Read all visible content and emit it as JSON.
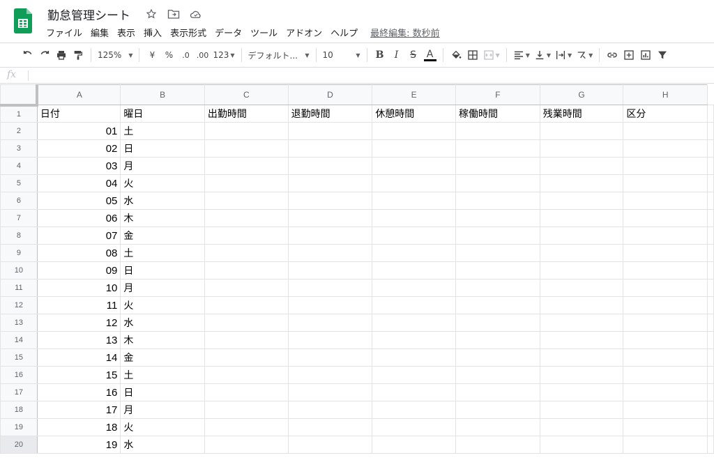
{
  "app": {
    "doc_title": "勤怠管理シート",
    "last_edit": "最終編集: 数秒前"
  },
  "menu": [
    "ファイル",
    "編集",
    "表示",
    "挿入",
    "表示形式",
    "データ",
    "ツール",
    "アドオン",
    "ヘルプ"
  ],
  "toolbar": {
    "zoom": "125%",
    "currency": "¥",
    "percent": "%",
    "decimal_decrease": ".0",
    "decimal_increase": ".00",
    "number_format": "123",
    "font": "デフォルト...",
    "font_size": "10",
    "bold": "B",
    "italic": "I",
    "strike": "S",
    "text_color": "A"
  },
  "formula_bar": {
    "fx_label": "fx"
  },
  "grid": {
    "columns": [
      "A",
      "B",
      "C",
      "D",
      "E",
      "F",
      "G",
      "H"
    ],
    "header_row": [
      "日付",
      "曜日",
      "出勤時間",
      "退勤時間",
      "休憩時間",
      "稼働時間",
      "残業時間",
      "区分"
    ],
    "rows": [
      {
        "n": "1"
      },
      {
        "n": "2",
        "a": "01",
        "b": "土"
      },
      {
        "n": "3",
        "a": "02",
        "b": "日"
      },
      {
        "n": "4",
        "a": "03",
        "b": "月"
      },
      {
        "n": "5",
        "a": "04",
        "b": "火"
      },
      {
        "n": "6",
        "a": "05",
        "b": "水"
      },
      {
        "n": "7",
        "a": "06",
        "b": "木"
      },
      {
        "n": "8",
        "a": "07",
        "b": "金"
      },
      {
        "n": "9",
        "a": "08",
        "b": "土"
      },
      {
        "n": "10",
        "a": "09",
        "b": "日"
      },
      {
        "n": "11",
        "a": "10",
        "b": "月"
      },
      {
        "n": "12",
        "a": "11",
        "b": "火"
      },
      {
        "n": "13",
        "a": "12",
        "b": "水"
      },
      {
        "n": "14",
        "a": "13",
        "b": "木"
      },
      {
        "n": "15",
        "a": "14",
        "b": "金"
      },
      {
        "n": "16",
        "a": "15",
        "b": "土"
      },
      {
        "n": "17",
        "a": "16",
        "b": "日"
      },
      {
        "n": "18",
        "a": "17",
        "b": "月"
      },
      {
        "n": "19",
        "a": "18",
        "b": "火"
      },
      {
        "n": "20",
        "a": "19",
        "b": "水"
      }
    ]
  },
  "colors": {
    "brand_green": "#0f9d58",
    "grid_line": "#e2e3e3",
    "header_bg": "#f8f9fa"
  }
}
